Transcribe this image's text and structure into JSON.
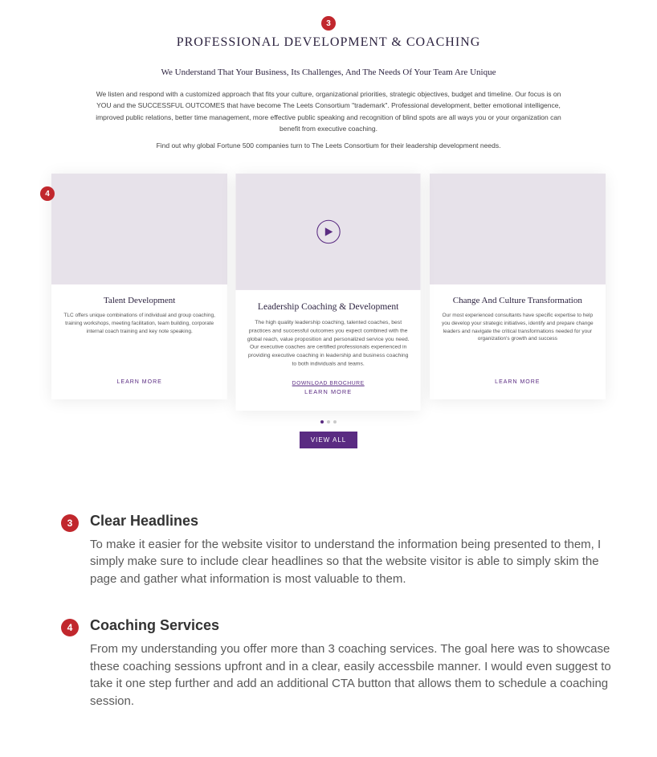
{
  "mockup": {
    "badge_top": "3",
    "section_title": "PROFESSIONAL DEVELOPMENT & COACHING",
    "subtitle": "We Understand That Your Business, Its Challenges, And The Needs Of Your Team Are Unique",
    "paragraph1": "We listen and respond with a customized approach that fits your culture, organizational priorities, strategic objectives, budget and timeline. Our focus is on YOU and the SUCCESSFUL OUTCOMES that have become The Leets Consortium \"trademark\". Professional development, better emotional intelligence, improved public relations, better time management, more effective public speaking and recognition of blind spots are all ways you or your organization can benefit from executive coaching.",
    "paragraph2": "Find out why global Fortune 500 companies turn to The Leets Consortium for their leadership development needs.",
    "badge_left": "4",
    "cards": [
      {
        "title": "Talent Development",
        "desc": "TLC offers unique combinations of individual and group coaching, training workshops, meeting facilitation, team building, corporate internal coach training and key note speaking.",
        "learn": "LEARN MORE"
      },
      {
        "title": "Leadership Coaching & Development",
        "desc": "The high quality leadership coaching, talented coaches, best practices and successful outcomes you expect combined with the global reach, value proposition and personalized service you need. Our executive coaches are certified professionals experienced in providing executive coaching in leadership and business coaching to both individuals and teams.",
        "brochure": "DOWNLOAD BROCHURE",
        "learn": "LEARN MORE"
      },
      {
        "title": "Change And Culture Transformation",
        "desc": "Our most experienced consultants have specific expertise to help you develop your strategic initiatives, identify and prepare change leaders and navigate the critical transformations needed for your organization's growth and success",
        "learn": "LEARN MORE"
      }
    ],
    "view_all": "VIEW ALL"
  },
  "annotations": [
    {
      "num": "3",
      "title": "Clear Headlines",
      "body": "To make it easier for the website visitor to understand the information being presented to them, I simply make sure to include clear headlines so that the website visitor is able to simply skim the page and gather what information is most valuable to them."
    },
    {
      "num": "4",
      "title": "Coaching Services",
      "body": "From my understanding you offer more than 3 coaching services. The goal here was to showcase these coaching sessions upfront and in a clear, easily accessbile manner. I would even suggest to take it one step further and add an additional CTA button that allows them to schedule a coaching session."
    }
  ]
}
